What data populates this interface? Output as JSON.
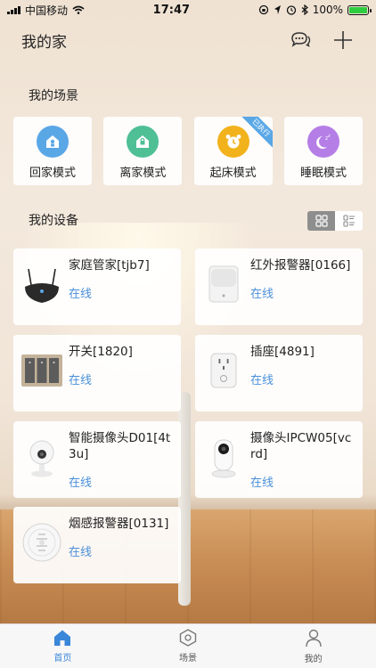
{
  "status_bar": {
    "carrier": "中国移动",
    "time": "17:47",
    "battery": "100%",
    "battery_level": 1.0
  },
  "header": {
    "title": "我的家",
    "message_icon": "chat-bubble-icon",
    "add_icon": "plus-icon"
  },
  "scenes_section": {
    "title": "我的场景",
    "items": [
      {
        "label": "回家模式",
        "icon": "home-arrive-icon",
        "color": "#5aa7e6"
      },
      {
        "label": "离家模式",
        "icon": "home-leave-icon",
        "color": "#4fbf96"
      },
      {
        "label": "起床模式",
        "icon": "alarm-clock-icon",
        "color": "#f2b21c",
        "badge": "已执行"
      },
      {
        "label": "睡眠模式",
        "icon": "moon-sleep-icon",
        "color": "#b57ee6"
      }
    ]
  },
  "devices_section": {
    "title": "我的设备",
    "view_grid_icon": "grid-view-icon",
    "view_list_icon": "list-view-icon",
    "items": [
      {
        "name": "家庭管家[tjb7]",
        "status": "在线",
        "icon": "gateway-hub-icon"
      },
      {
        "name": "红外报警器[0166]",
        "status": "在线",
        "icon": "infrared-sensor-icon"
      },
      {
        "name": "开关[1820]",
        "status": "在线",
        "icon": "wall-switch-icon"
      },
      {
        "name": "插座[4891]",
        "status": "在线",
        "icon": "smart-socket-icon"
      },
      {
        "name": "智能摄像头D01[4t3u]",
        "status": "在线",
        "icon": "dome-camera-icon"
      },
      {
        "name": "摄像头IPCW05[vcrd]",
        "status": "在线",
        "icon": "ip-camera-icon"
      },
      {
        "name": "烟感报警器[0131]",
        "status": "在线",
        "icon": "smoke-detector-icon"
      }
    ]
  },
  "tab_bar": {
    "items": [
      {
        "label": "首页",
        "icon": "home-icon",
        "active": true
      },
      {
        "label": "场景",
        "icon": "hexagon-scene-icon",
        "active": false
      },
      {
        "label": "我的",
        "icon": "user-icon",
        "active": false
      }
    ]
  },
  "colors": {
    "accent": "#3a86d8",
    "online": "#4a90d9"
  }
}
